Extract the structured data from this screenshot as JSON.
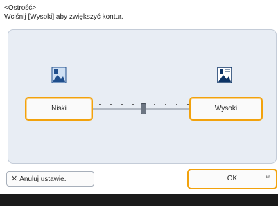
{
  "header": {
    "title": "<Ostrość>",
    "instruction": "Wciśnij [Wysoki] aby zwiększyć kontur."
  },
  "scale": {
    "low_label": "Niski",
    "high_label": "Wysoki",
    "positions": 9,
    "value": 5
  },
  "footer": {
    "cancel_label": "Anuluj ustawie.",
    "ok_label": "OK"
  },
  "colors": {
    "accent": "#f2a20c",
    "panel": "#e8edf4",
    "icon_blue": "#1f4e8c"
  },
  "icons": {
    "low": "landscape-icon",
    "high": "landscape-sharp-icon",
    "cancel": "close-icon",
    "enter": "enter-icon"
  }
}
